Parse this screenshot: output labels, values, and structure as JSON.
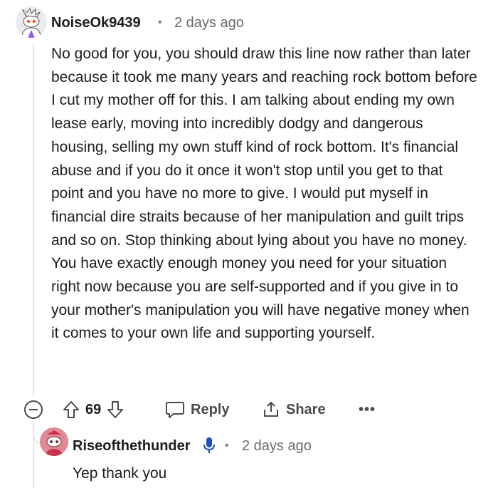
{
  "comment": {
    "username": "NoiseOk9439",
    "separator": "•",
    "time": "2 days ago",
    "body": "No good for you, you should draw this line now rather than later because it took me many years and reaching rock bottom before I cut my mother off for this. I am talking about ending my own lease early, moving into incredibly dodgy and dangerous housing, selling my own stuff kind of rock bottom. It's financial abuse and if you do it once it won't stop until you get to that point and you have no more to give. I would put myself in financial dire straits because of her manipulation and guilt trips and so on. Stop thinking about lying about you have no money. You have exactly enough money you need for your situation right now because you are self-supported and if you give in to your mother's manipulation you will have negative money when it comes to your own life and supporting yourself.",
    "votes": "69"
  },
  "actions": {
    "reply_label": "Reply",
    "share_label": "Share",
    "more_label": "•••"
  },
  "reply": {
    "username": "Riseofthethunder",
    "separator": "•",
    "time": "2 days ago",
    "body": "Yep thank you"
  },
  "icons": {
    "collapse": "collapse-icon",
    "upvote": "upvote-icon",
    "downvote": "downvote-icon",
    "reply": "reply-icon",
    "share": "share-icon",
    "more": "more-icon",
    "mic": "mic-icon"
  },
  "colors": {
    "text": "#1c1c1c",
    "muted": "#6a6a6a",
    "action": "#4a4a4a",
    "mic": "#1b4fbf",
    "avatar_reply": "#e08a96"
  }
}
